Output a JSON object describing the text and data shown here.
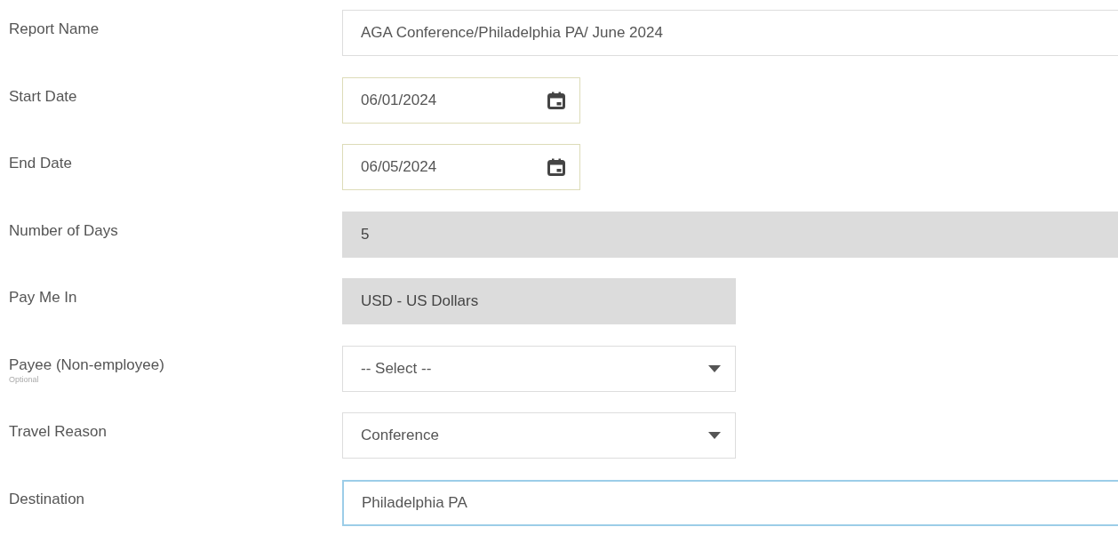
{
  "fields": [
    {
      "label": "Report Name",
      "kind": "text",
      "value": "AGA Conference/Philadelphia PA/ June 2024",
      "focused": false
    },
    {
      "label": "Start Date",
      "kind": "date",
      "value": "06/01/2024",
      "focused": false
    },
    {
      "label": "End Date",
      "kind": "date",
      "value": "06/05/2024",
      "focused": false
    },
    {
      "label": "Number of Days",
      "kind": "readonly",
      "value": "5",
      "focused": false
    },
    {
      "label": "Pay Me In",
      "kind": "currency",
      "value": "USD - US Dollars",
      "focused": false
    },
    {
      "label": "Payee (Non-employee)",
      "hint": "Optional",
      "kind": "select",
      "value": "-- Select --",
      "focused": false
    },
    {
      "label": "Travel Reason",
      "kind": "select",
      "value": "Conference",
      "focused": false
    },
    {
      "label": "Destination",
      "kind": "text",
      "value": "Philadelphia PA",
      "focused": true
    }
  ]
}
